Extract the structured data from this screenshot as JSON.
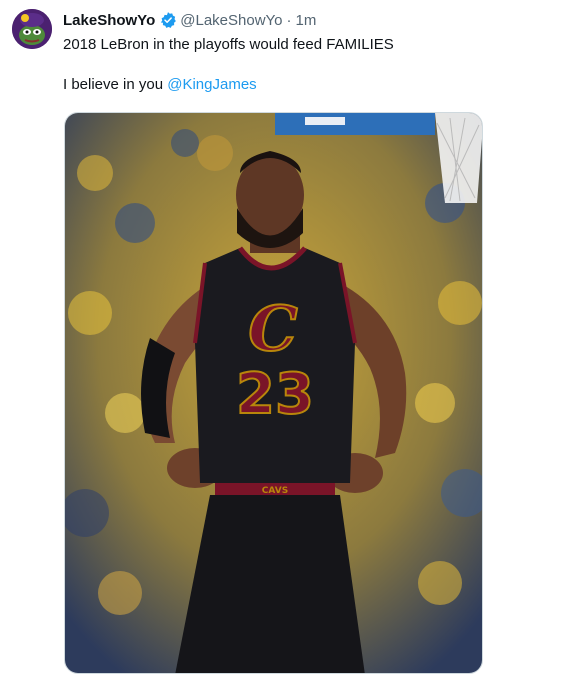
{
  "tweet": {
    "author": {
      "display_name": "LakeShowYo",
      "handle": "@LakeShowYo",
      "verified": true,
      "avatar_icon": "pepe-avatar-icon"
    },
    "separator": "·",
    "time": "1m",
    "text_line1": "2018 LeBron in the playoffs would feed FAMILIES",
    "text_line2_prefix": "I believe in you ",
    "mention": "@KingJames",
    "media": {
      "jersey_number": "23",
      "jersey_logo": "C",
      "waistband_text": "CAVS"
    },
    "colors": {
      "mention": "#1d9bf0",
      "verified": "#1d9bf0",
      "secondary_text": "#536471",
      "jersey": "#1a1a1f",
      "jersey_trim": "#b8860b",
      "jersey_red": "#7a1428"
    }
  }
}
